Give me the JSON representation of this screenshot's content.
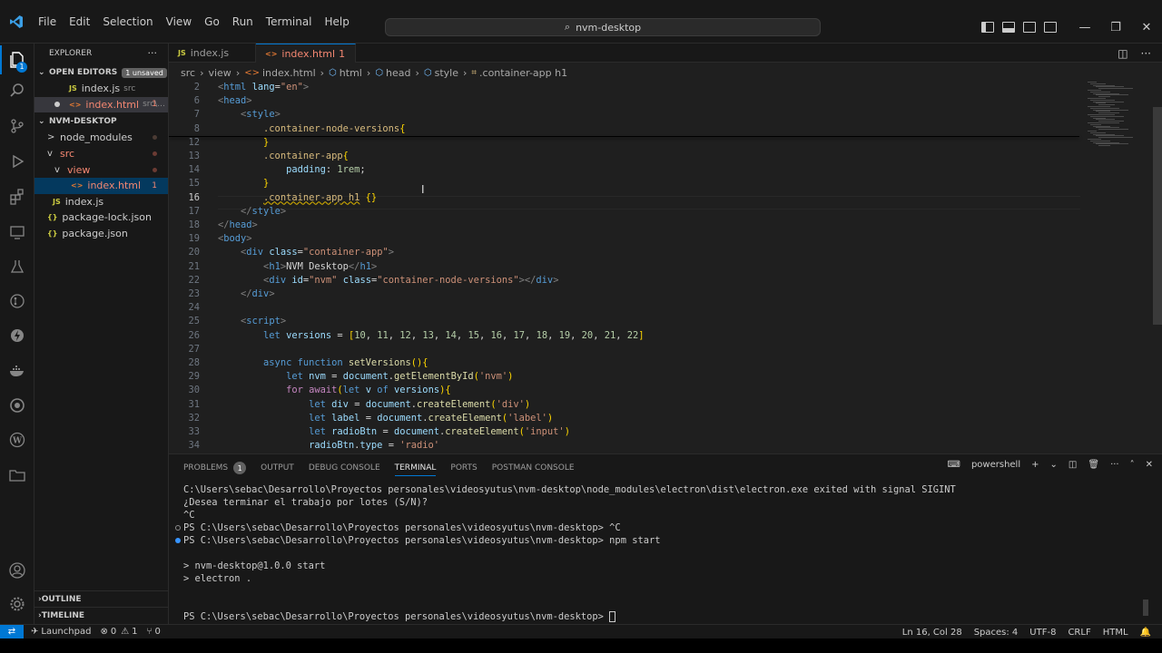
{
  "window": {
    "menu": [
      "File",
      "Edit",
      "Selection",
      "View",
      "Go",
      "Run",
      "Terminal",
      "Help"
    ],
    "command_center": "nvm-desktop",
    "icons": [
      "vscode-logo",
      "back-arrow",
      "forward-arrow",
      "search-icon",
      "minimize",
      "restore",
      "close"
    ]
  },
  "activity": {
    "explorer_badge": "1",
    "icons": [
      "files-icon",
      "search-icon",
      "source-control-icon",
      "run-debug-icon",
      "extensions-icon",
      "remote-explorer-icon",
      "testing-icon",
      "git-graph-icon",
      "thunder-client-icon",
      "docker-icon",
      "gitlens-icon",
      "wordpress-icon",
      "project-manager-icon",
      "account-icon",
      "gear-icon"
    ]
  },
  "sidebar": {
    "title": "EXPLORER",
    "more": "···",
    "open_editors": {
      "label": "OPEN EDITORS",
      "badge": "1 unsaved"
    },
    "open_files": [
      {
        "type": "JS",
        "name": "index.js",
        "hint": "src"
      },
      {
        "type": "<>",
        "name": "index.html",
        "hint": "src\\...",
        "count": "1"
      }
    ],
    "project": {
      "label": "NVM-DESKTOP"
    },
    "tree": [
      {
        "type": ">",
        "name": "node_modules"
      },
      {
        "type": "v",
        "name": "src"
      },
      {
        "type": "v",
        "name": "view"
      },
      {
        "type": "<>",
        "name": "index.html",
        "count": "1"
      },
      {
        "type": "JS",
        "name": "index.js"
      },
      {
        "type": "{}",
        "name": "package-lock.json"
      },
      {
        "type": "{}",
        "name": "package.json"
      }
    ],
    "outline": "OUTLINE",
    "timeline": "TIMELINE"
  },
  "tabs": [
    {
      "type": "JS",
      "name": "index.js"
    },
    {
      "type": "<>",
      "name": "index.html",
      "count": "1"
    }
  ],
  "breadcrumb": [
    "src",
    "view",
    "index.html",
    "html",
    "head",
    "style",
    ".container-app h1"
  ],
  "editor": {
    "cursor_line": "16",
    "line_numbers": [
      "2",
      "6",
      "7",
      "8",
      "12",
      "13",
      "14",
      "15",
      "16",
      "17",
      "18",
      "19",
      "20",
      "21",
      "22",
      "23",
      "24",
      "25",
      "26",
      "27",
      "28",
      "29",
      "30",
      "31",
      "32",
      "33",
      "34"
    ],
    "lines": [
      "<html lang=\"en\">",
      "<head>",
      "    <style>",
      "        .container-node-versions{",
      "        }",
      "        .container-app{",
      "            padding: 1rem;",
      "        }",
      "        .container-app h1 {}",
      "    </style>",
      "</head>",
      "<body>",
      "    <div class=\"container-app\">",
      "        <h1>NVM Desktop</h1>",
      "        <div id=\"nvm\" class=\"container-node-versions\"></div>",
      "    </div>",
      "",
      "    <script>",
      "        let versions = [10, 11, 12, 13, 14, 15, 16, 17, 18, 19, 20, 21, 22]",
      "",
      "        async function setVersions(){",
      "            let nvm = document.getElementById('nvm')",
      "            for await(let v of versions){",
      "                let div = document.createElement('div')",
      "                let label = document.createElement('label')",
      "                let radioBtn = document.createElement('input')",
      "                radioBtn.type = 'radio'"
    ]
  },
  "panel": {
    "tabs": [
      "PROBLEMS",
      "OUTPUT",
      "DEBUG CONSOLE",
      "TERMINAL",
      "PORTS",
      "POSTMAN CONSOLE"
    ],
    "problems_count": "1",
    "active_tab": "TERMINAL",
    "shell": "powershell",
    "terminal_lines": [
      "C:\\Users\\sebac\\Desarrollo\\Proyectos personales\\videosyutus\\nvm-desktop\\node_modules\\electron\\dist\\electron.exe exited with signal SIGINT",
      "¿Desea terminar el trabajo por lotes (S/N)?",
      "^C",
      "PS C:\\Users\\sebac\\Desarrollo\\Proyectos personales\\videosyutus\\nvm-desktop> ^C",
      "PS C:\\Users\\sebac\\Desarrollo\\Proyectos personales\\videosyutus\\nvm-desktop> npm start",
      "",
      "> nvm-desktop@1.0.0 start",
      "> electron .",
      "",
      "",
      "PS C:\\Users\\sebac\\Desarrollo\\Proyectos personales\\videosyutus\\nvm-desktop> "
    ]
  },
  "status": {
    "launchpad": "Launchpad",
    "errors": "0",
    "warnings": "1",
    "ports": "0",
    "position": "Ln 16, Col 28",
    "spaces": "Spaces: 4",
    "encoding": "UTF-8",
    "eol": "CRLF",
    "language": "HTML"
  },
  "colors": {
    "accent": "#0078d4",
    "background": "#1f1f1f",
    "sidebar": "#181818",
    "error": "#f48771"
  }
}
